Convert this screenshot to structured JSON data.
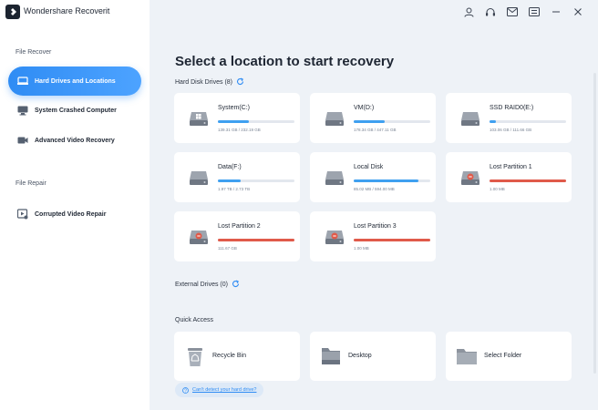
{
  "window": {
    "title": "Wondershare Recoverit"
  },
  "titlebar_icons": [
    "user-icon",
    "headset-icon",
    "mail-icon",
    "menu-icon",
    "minimize-icon",
    "close-icon"
  ],
  "sidebar": {
    "section_recover": "File Recover",
    "section_repair": "File Repair",
    "items": [
      {
        "label": "Hard Drives and Locations",
        "icon": "hard-drive-icon",
        "active": true
      },
      {
        "label": "System Crashed Computer",
        "icon": "computer-icon",
        "active": false
      },
      {
        "label": "Advanced Video Recovery",
        "icon": "video-camera-icon",
        "active": false
      },
      {
        "label": "Corrupted Video Repair",
        "icon": "video-repair-icon",
        "active": false
      }
    ]
  },
  "main": {
    "title": "Select a location to start recovery",
    "hard_disk_label": "Hard Disk Drives (8)",
    "external_label": "External Drives (0)",
    "quick_access_label": "Quick Access",
    "help_link": "Can't detect your hard drive?"
  },
  "drives": [
    {
      "name": "System(C:)",
      "size": "139.31 GB / 232.19 GB",
      "fraction": 0.4,
      "color": "#3fa0f0",
      "type": "windows"
    },
    {
      "name": "VM(D:)",
      "size": "178.34 GB / 447.11 GB",
      "fraction": 0.4,
      "color": "#3fa0f0",
      "type": "normal"
    },
    {
      "name": "SSD RAID0(E:)",
      "size": "103.06 GB / 111.66 GB",
      "fraction": 0.08,
      "color": "#3fa0f0",
      "type": "normal"
    },
    {
      "name": "Data(F:)",
      "size": "1.97 TB / 2.73 TB",
      "fraction": 0.3,
      "color": "#3fa0f0",
      "type": "normal"
    },
    {
      "name": "Local Disk",
      "size": "85.02 MB / 594.00 MB",
      "fraction": 0.85,
      "color": "#3fa0f0",
      "type": "normal"
    },
    {
      "name": "Lost Partition 1",
      "size": "1.00 MB",
      "fraction": 1.0,
      "color": "#e05a4a",
      "type": "lost"
    },
    {
      "name": "Lost Partition 2",
      "size": "111.67 GB",
      "fraction": 1.0,
      "color": "#e05a4a",
      "type": "lost"
    },
    {
      "name": "Lost Partition 3",
      "size": "1.00 MB",
      "fraction": 1.0,
      "color": "#e05a4a",
      "type": "lost"
    }
  ],
  "quick_access": [
    {
      "label": "Recycle Bin",
      "icon": "recycle-bin-icon"
    },
    {
      "label": "Desktop",
      "icon": "desktop-icon"
    },
    {
      "label": "Select Folder",
      "icon": "folder-icon"
    }
  ],
  "colors": {
    "accent": "#2f8cf4",
    "used_bar": "#3fa0f0",
    "lost_bar": "#e05a4a"
  }
}
